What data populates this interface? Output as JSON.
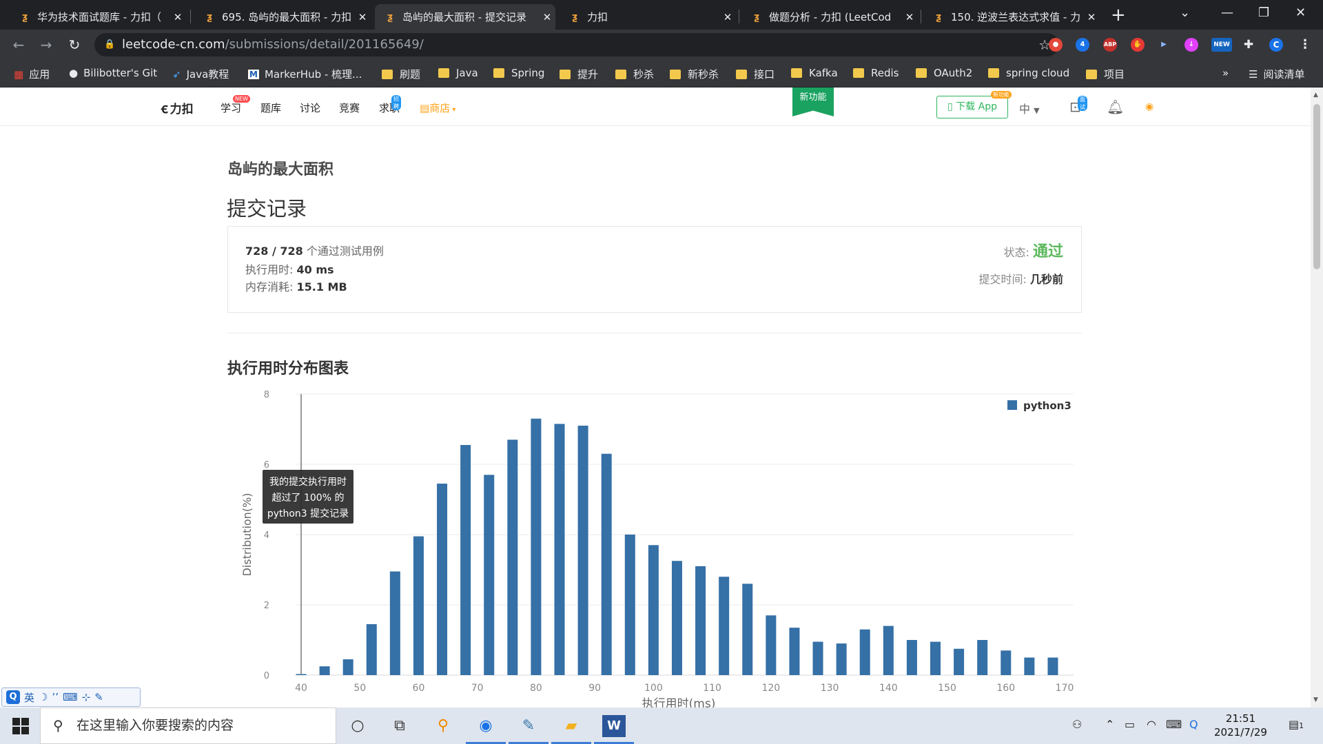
{
  "browser": {
    "tabs": [
      {
        "title": "华为技术面试题库 - 力扣（",
        "active": false
      },
      {
        "title": "695. 岛屿的最大面积 - 力扣",
        "active": false
      },
      {
        "title": "岛屿的最大面积 - 提交记录",
        "active": true
      },
      {
        "title": "力扣",
        "active": false
      },
      {
        "title": "做题分析 - 力扣 (LeetCod",
        "active": false
      },
      {
        "title": "150. 逆波兰表达式求值 - 力",
        "active": false
      }
    ],
    "url_host": "leetcode-cn.com",
    "url_path": "/submissions/detail/201165649/",
    "extension_badge_count": "4",
    "extension_abp": "ABP",
    "extension_new": "NEW",
    "profile_initial": "C"
  },
  "bookmarks": {
    "apps": "应用",
    "items": [
      "Bilibotter's Git",
      "Java教程",
      "MarkerHub - 梳理...",
      "刷题",
      "Java",
      "Spring",
      "提升",
      "秒杀",
      "新秒杀",
      "接口",
      "Kafka",
      "Redis",
      "OAuth2",
      "spring cloud",
      "项目"
    ],
    "overflow": "»",
    "reading_list": "阅读清单"
  },
  "site": {
    "logo": "力扣",
    "nav": [
      {
        "label": "学习",
        "badge": "NEW"
      },
      {
        "label": "题库",
        "badge": ""
      },
      {
        "label": "讨论",
        "badge": ""
      },
      {
        "label": "竞赛",
        "badge": ""
      },
      {
        "label": "求职",
        "badge": "招聘"
      }
    ],
    "shop": "商店",
    "new_feature": "新功能",
    "download_app": "下载 App",
    "download_badge": "新功能",
    "lang": "中",
    "interview_badge": "面试"
  },
  "submission": {
    "problem_title": "岛屿的最大面积",
    "heading": "提交记录",
    "passed": "728 / 728",
    "passed_suffix": "个通过测试用例",
    "runtime_label": "执行用时:",
    "runtime_value": "40 ms",
    "memory_label": "内存消耗:",
    "memory_value": "15.1 MB",
    "status_label": "状态:",
    "status_value": "通过",
    "time_label": "提交时间:",
    "time_value": "几秒前"
  },
  "chart_section_title": "执行用时分布图表",
  "chart_data": {
    "type": "bar",
    "x": [
      40,
      44,
      48,
      52,
      56,
      60,
      64,
      68,
      72,
      76,
      80,
      84,
      88,
      92,
      96,
      100,
      104,
      108,
      112,
      116,
      120,
      124,
      128,
      132,
      136,
      140,
      144,
      148,
      152,
      156,
      160,
      164,
      168
    ],
    "series": [
      {
        "name": "python3",
        "values": [
          0.03,
          0.25,
          0.45,
          1.45,
          2.95,
          3.95,
          5.45,
          6.55,
          5.7,
          6.7,
          7.3,
          7.15,
          7.1,
          6.3,
          4.0,
          3.7,
          3.25,
          3.1,
          2.8,
          2.6,
          1.7,
          1.35,
          0.95,
          0.9,
          1.3,
          1.4,
          1.0,
          0.95,
          0.75,
          1.0,
          0.7,
          0.5,
          0.5
        ]
      }
    ],
    "xlabel": "执行用时(ms)",
    "ylabel": "Distribution(%)",
    "xticks": [
      40,
      50,
      60,
      70,
      80,
      90,
      100,
      110,
      120,
      130,
      140,
      150,
      160,
      170
    ],
    "yticks": [
      0,
      2,
      4,
      6,
      8
    ],
    "xlim": [
      40,
      170
    ],
    "ylim": [
      0,
      8
    ],
    "grid": true,
    "legend": "top-right",
    "color": "#3570a6",
    "marker_x": 40,
    "tooltip": [
      "我的提交执行用时",
      "超过了 100% 的",
      "python3 提交记录"
    ]
  },
  "ime": {
    "lang": "英"
  },
  "taskbar": {
    "search_placeholder": "在这里输入你要搜索的内容",
    "time": "21:51",
    "date": "2021/7/29",
    "notification_count": "1"
  }
}
